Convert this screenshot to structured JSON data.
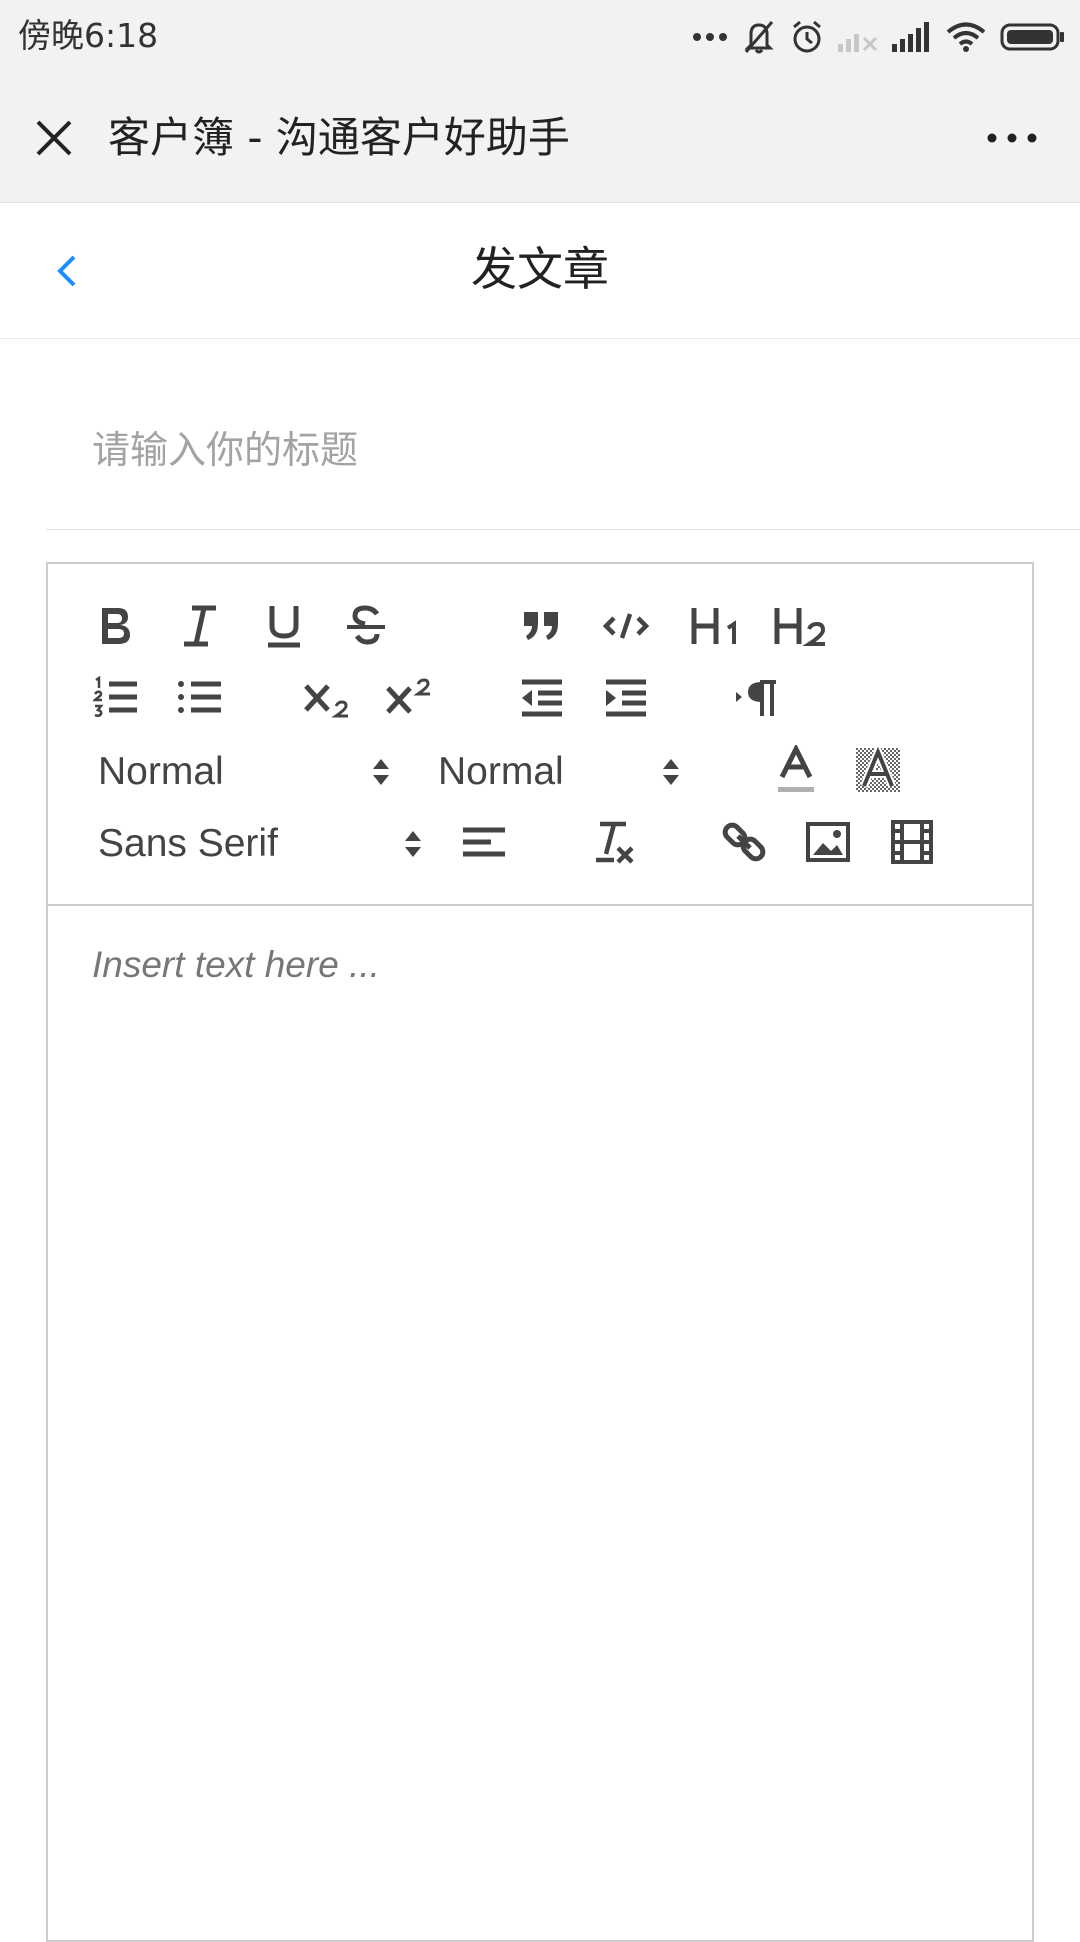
{
  "status_bar": {
    "time": "傍晚6:18",
    "icons": [
      "more-dots-icon",
      "bell-muted-icon",
      "alarm-icon",
      "signal-sim1-icon",
      "signal-sim2-icon",
      "wifi-icon",
      "battery-icon"
    ]
  },
  "miniprogram": {
    "title": "客户簿 - 沟通客户好助手",
    "close_icon": "close-icon",
    "more_icon": "more-icon"
  },
  "header": {
    "title": "发文章",
    "back_icon": "chevron-left-icon",
    "accent_color": "#1a8cff"
  },
  "title_input": {
    "placeholder": "请输入你的标题",
    "value": ""
  },
  "toolbar": {
    "row1": [
      "bold",
      "italic",
      "underline",
      "strike",
      "blockquote",
      "code-block",
      "header-1",
      "header-2"
    ],
    "row2": [
      "list-ordered",
      "list-bullet",
      "subscript",
      "superscript",
      "indent-decrease",
      "indent-increase",
      "direction-rtl"
    ],
    "size_picker_label": "Normal",
    "header_picker_label": "Normal",
    "font_picker_label": "Sans Serif",
    "row3_icons": [
      "text-color",
      "background-color"
    ],
    "row4_icons": [
      "align",
      "clean-format",
      "link",
      "image",
      "video"
    ]
  },
  "editor": {
    "placeholder": "Insert text here ..."
  }
}
